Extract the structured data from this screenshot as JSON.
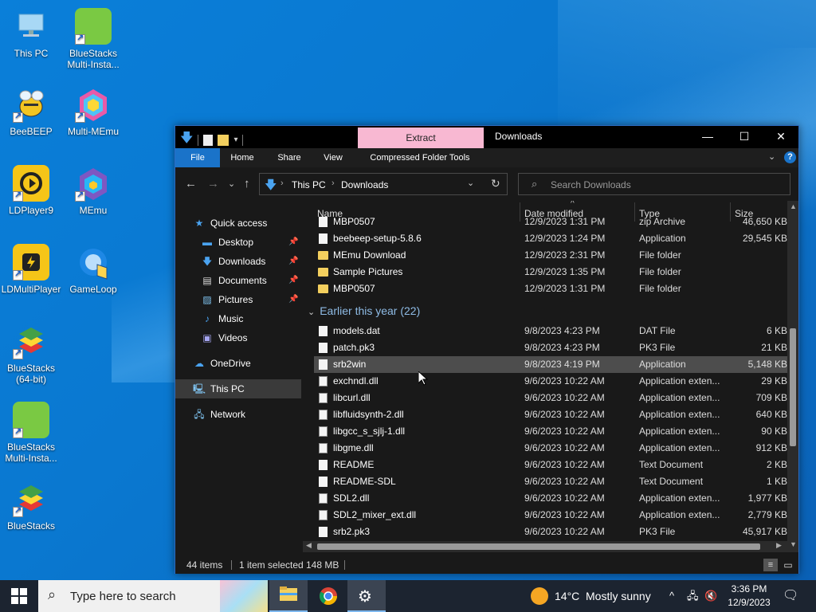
{
  "desktop": {
    "icons": [
      {
        "label": "This PC"
      },
      {
        "label": "BlueStacks Multi-Insta..."
      },
      {
        "label": "BeeBEEP"
      },
      {
        "label": "Multi-MEmu"
      },
      {
        "label": "LDPlayer9"
      },
      {
        "label": "MEmu"
      },
      {
        "label": "LDMultiPlayer"
      },
      {
        "label": "GameLoop"
      },
      {
        "label": "BlueStacks (64-bit)"
      },
      {
        "label": "BlueStacks Multi-Insta..."
      },
      {
        "label": "BlueStacks"
      }
    ]
  },
  "explorer": {
    "title": "Downloads",
    "extract_tab": "Extract",
    "ribbon_tabs": [
      "File",
      "Home",
      "Share",
      "View",
      "Compressed Folder Tools"
    ],
    "breadcrumb": [
      "This PC",
      "Downloads"
    ],
    "search_placeholder": "Search Downloads",
    "nav": {
      "quick_access": "Quick access",
      "items": [
        {
          "label": "Desktop",
          "pinned": true
        },
        {
          "label": "Downloads",
          "pinned": true
        },
        {
          "label": "Documents",
          "pinned": true
        },
        {
          "label": "Pictures",
          "pinned": true
        },
        {
          "label": "Music"
        },
        {
          "label": "Videos"
        }
      ],
      "onedrive": "OneDrive",
      "this_pc": "This PC",
      "network": "Network"
    },
    "columns": [
      "Name",
      "Date modified",
      "Type",
      "Size"
    ],
    "top_rows": [
      {
        "name": "MBP0507",
        "date": "12/9/2023 1:31 PM",
        "type": "zip Archive",
        "size": "46,650 KB",
        "icon": "zip"
      },
      {
        "name": "beebeep-setup-5.8.6",
        "date": "12/9/2023 1:24 PM",
        "type": "Application",
        "size": "29,545 KB",
        "icon": "app"
      },
      {
        "name": "MEmu Download",
        "date": "12/9/2023 2:31 PM",
        "type": "File folder",
        "size": "",
        "icon": "folder"
      },
      {
        "name": "Sample Pictures",
        "date": "12/9/2023 1:35 PM",
        "type": "File folder",
        "size": "",
        "icon": "folder"
      },
      {
        "name": "MBP0507",
        "date": "12/9/2023 1:31 PM",
        "type": "File folder",
        "size": "",
        "icon": "folder"
      }
    ],
    "group_label": "Earlier this year (22)",
    "rows": [
      {
        "name": "models.dat",
        "date": "9/8/2023 4:23 PM",
        "type": "DAT File",
        "size": "6 KB",
        "icon": "doc"
      },
      {
        "name": "patch.pk3",
        "date": "9/8/2023 4:23 PM",
        "type": "PK3 File",
        "size": "21 KB",
        "icon": "doc"
      },
      {
        "name": "srb2win",
        "date": "9/8/2023 4:19 PM",
        "type": "Application",
        "size": "5,148 KB",
        "icon": "doc",
        "selected": true
      },
      {
        "name": "exchndl.dll",
        "date": "9/6/2023 10:22 AM",
        "type": "Application exten...",
        "size": "29 KB",
        "icon": "dll"
      },
      {
        "name": "libcurl.dll",
        "date": "9/6/2023 10:22 AM",
        "type": "Application exten...",
        "size": "709 KB",
        "icon": "dll"
      },
      {
        "name": "libfluidsynth-2.dll",
        "date": "9/6/2023 10:22 AM",
        "type": "Application exten...",
        "size": "640 KB",
        "icon": "dll"
      },
      {
        "name": "libgcc_s_sjlj-1.dll",
        "date": "9/6/2023 10:22 AM",
        "type": "Application exten...",
        "size": "90 KB",
        "icon": "dll"
      },
      {
        "name": "libgme.dll",
        "date": "9/6/2023 10:22 AM",
        "type": "Application exten...",
        "size": "912 KB",
        "icon": "dll"
      },
      {
        "name": "README",
        "date": "9/6/2023 10:22 AM",
        "type": "Text Document",
        "size": "2 KB",
        "icon": "txt"
      },
      {
        "name": "README-SDL",
        "date": "9/6/2023 10:22 AM",
        "type": "Text Document",
        "size": "1 KB",
        "icon": "txt"
      },
      {
        "name": "SDL2.dll",
        "date": "9/6/2023 10:22 AM",
        "type": "Application exten...",
        "size": "1,977 KB",
        "icon": "dll"
      },
      {
        "name": "SDL2_mixer_ext.dll",
        "date": "9/6/2023 10:22 AM",
        "type": "Application exten...",
        "size": "2,779 KB",
        "icon": "dll"
      },
      {
        "name": "srb2.pk3",
        "date": "9/6/2023 10:22 AM",
        "type": "PK3 File",
        "size": "45,917 KB",
        "icon": "doc"
      }
    ],
    "status": {
      "items": "44 items",
      "selected": "1 item selected",
      "size": "148 MB"
    }
  },
  "taskbar": {
    "search_placeholder": "Type here to search",
    "weather_temp": "14°C",
    "weather_text": "Mostly sunny",
    "time": "3:36 PM",
    "date": "12/9/2023"
  },
  "colors": {
    "accent": "#1a73c9",
    "extract_tab": "#f8b8d2",
    "folder": "#f3cf5e"
  }
}
